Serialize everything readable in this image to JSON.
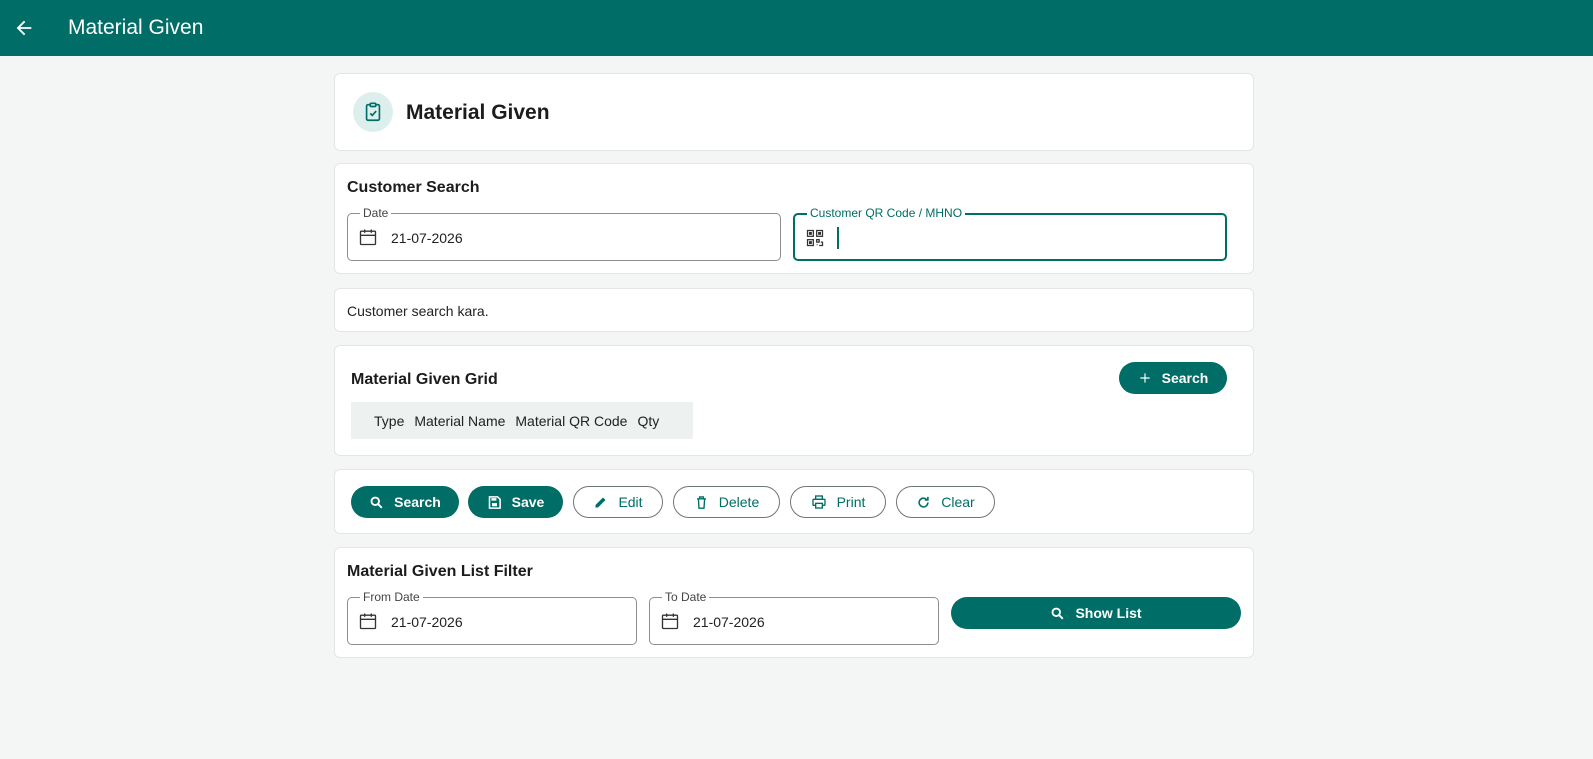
{
  "appbar": {
    "title": "Material Given",
    "back_icon": "arrow-left-icon"
  },
  "header": {
    "title": "Material Given",
    "icon": "clipboard-check-icon"
  },
  "customer_search": {
    "title": "Customer Search",
    "date": {
      "label": "Date",
      "value": "21-07-2026",
      "icon": "calendar-icon"
    },
    "qr": {
      "label": "Customer QR Code / MHNO",
      "value": "",
      "icon": "qr-code-icon"
    }
  },
  "message": "Customer search kara.",
  "grid": {
    "title": "Material Given Grid",
    "search_button": "Search",
    "columns": [
      "Type",
      "Material Name",
      "Material QR Code",
      "Qty"
    ]
  },
  "actions": {
    "search": "Search",
    "save": "Save",
    "edit": "Edit",
    "delete": "Delete",
    "print": "Print",
    "clear": "Clear"
  },
  "filter": {
    "title": "Material Given List Filter",
    "from_date": {
      "label": "From Date",
      "value": "21-07-2026"
    },
    "to_date": {
      "label": "To Date",
      "value": "21-07-2026"
    },
    "show_list": "Show List"
  },
  "colors": {
    "primary": "#006d66",
    "background": "#f3f6f5",
    "icon_bg": "#dcefed"
  }
}
